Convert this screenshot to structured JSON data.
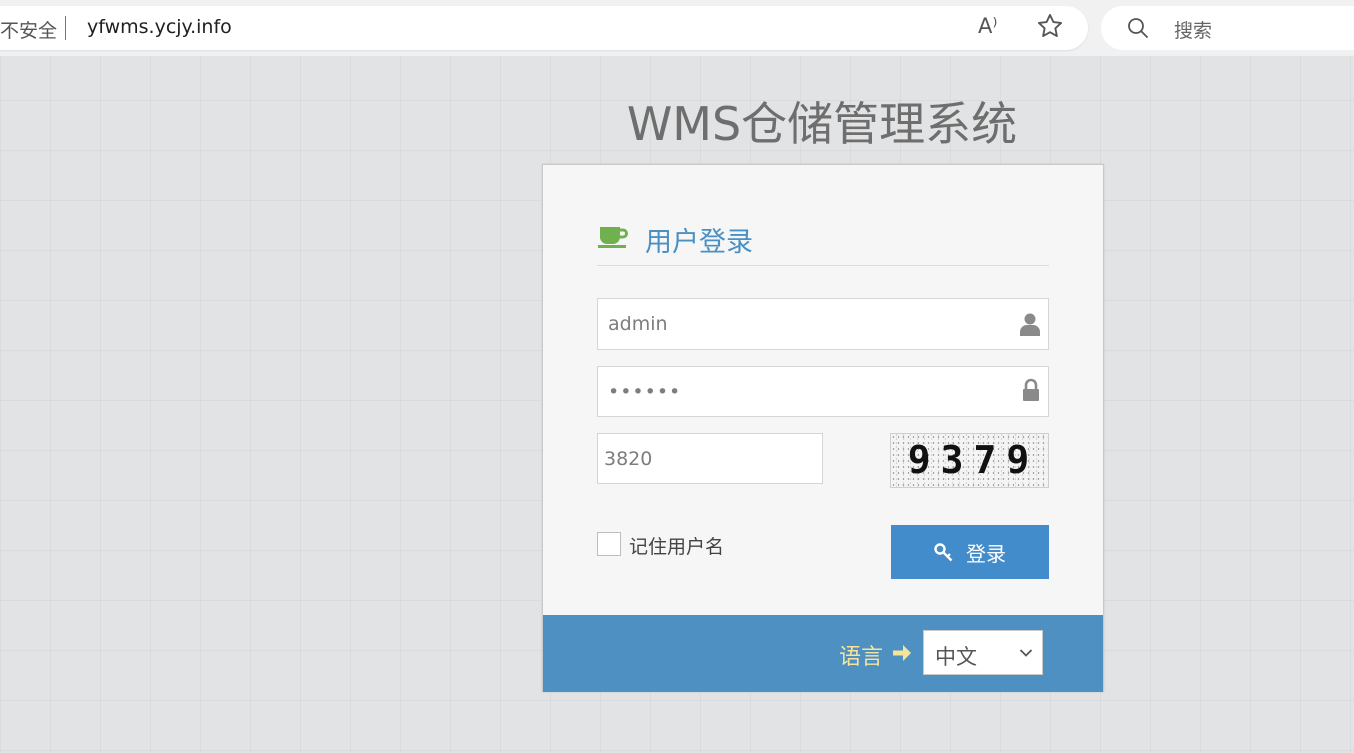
{
  "browser": {
    "security_text": "不安全",
    "url": "yfwms.ycjy.info",
    "read_aloud_glyph": "A⁾",
    "search_placeholder": "搜索"
  },
  "page": {
    "title": "WMS仓储管理系统"
  },
  "login": {
    "heading": "用户登录",
    "username_value": "admin",
    "password_value": "••••••",
    "captcha_input_value": "3820",
    "captcha_image_text": "9379",
    "remember_label": "记住用户名",
    "submit_label": "登录"
  },
  "footer": {
    "language_label": "语言",
    "language_selected": "中文"
  },
  "colors": {
    "accent_blue": "#438ccb",
    "footer_blue": "#4f90c3",
    "heading_blue": "#4a90c4",
    "coffee_green": "#6fb04f",
    "language_yellow": "#f7e39a"
  }
}
